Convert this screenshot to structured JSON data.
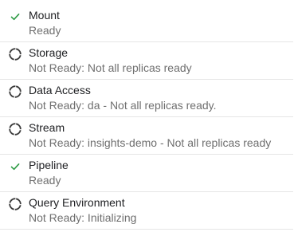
{
  "colors": {
    "ready_check": "#2e9b45",
    "pending_ring": "#3c3c3c",
    "name_text": "#202124",
    "detail_text": "#6f6f6f",
    "divider": "#e6e6e6"
  },
  "components": [
    {
      "name": "Mount",
      "status_text": "Ready",
      "icon": "check-icon"
    },
    {
      "name": "Storage",
      "status_text": "Not Ready: Not all replicas ready",
      "icon": "pending-icon"
    },
    {
      "name": "Data Access",
      "status_text": "Not Ready: da - Not all replicas ready.",
      "icon": "pending-icon"
    },
    {
      "name": "Stream",
      "status_text": "Not Ready: insights-demo - Not all replicas ready",
      "icon": "pending-icon"
    },
    {
      "name": "Pipeline",
      "status_text": "Ready",
      "icon": "check-icon"
    },
    {
      "name": "Query Environment",
      "status_text": "Not Ready: Initializing",
      "icon": "pending-icon"
    }
  ]
}
